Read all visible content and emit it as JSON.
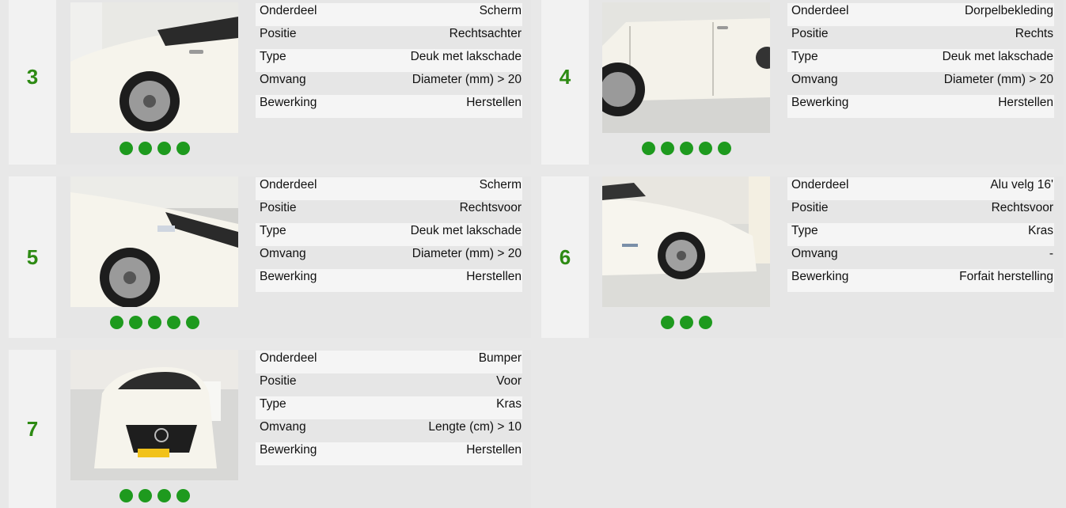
{
  "labels": {
    "onderdeel": "Onderdeel",
    "positie": "Positie",
    "type": "Type",
    "omvang": "Omvang",
    "bewerking": "Bewerking"
  },
  "damages": [
    {
      "number": "3",
      "onderdeel": "Scherm",
      "positie": "Rechtsachter",
      "type": "Deuk met lakschade",
      "omvang": "Diameter (mm) > 20",
      "bewerking": "Herstellen",
      "photo_count": 4
    },
    {
      "number": "4",
      "onderdeel": "Dorpelbekleding",
      "positie": "Rechts",
      "type": "Deuk met lakschade",
      "omvang": "Diameter (mm) > 20",
      "bewerking": "Herstellen",
      "photo_count": 5
    },
    {
      "number": "5",
      "onderdeel": "Scherm",
      "positie": "Rechtsvoor",
      "type": "Deuk met lakschade",
      "omvang": "Diameter (mm) > 20",
      "bewerking": "Herstellen",
      "photo_count": 5
    },
    {
      "number": "6",
      "onderdeel": "Alu velg 16'",
      "positie": "Rechtsvoor",
      "type": "Kras",
      "omvang": "-",
      "bewerking": "Forfait herstelling",
      "photo_count": 3
    },
    {
      "number": "7",
      "onderdeel": "Bumper",
      "positie": "Voor",
      "type": "Kras",
      "omvang": "Lengte (cm) > 10",
      "bewerking": "Herstellen",
      "photo_count": 4
    }
  ]
}
